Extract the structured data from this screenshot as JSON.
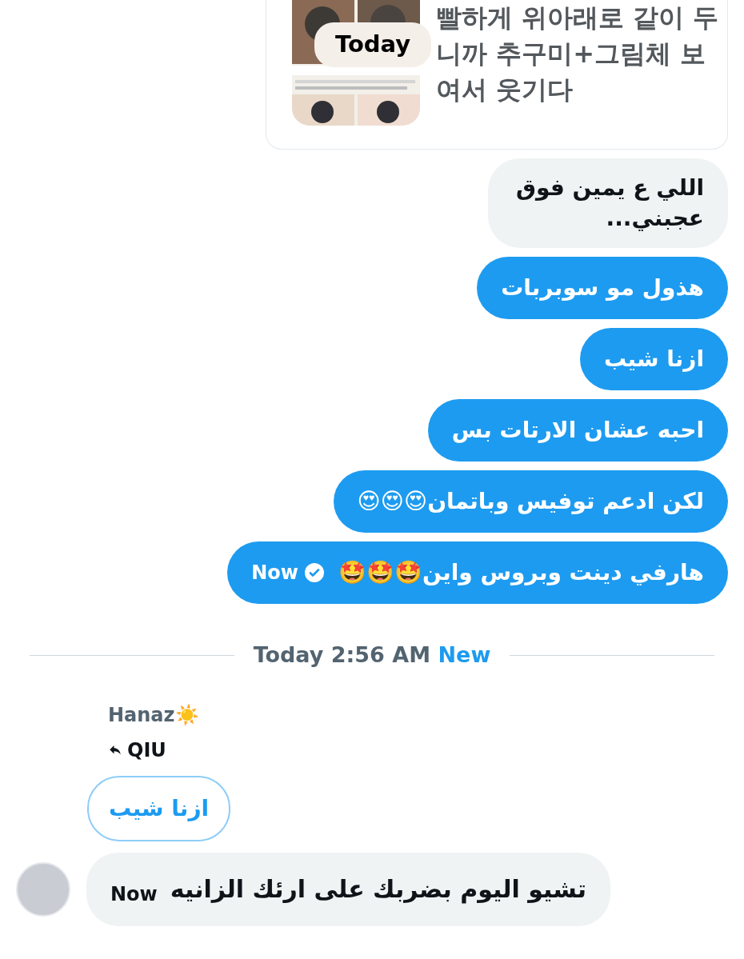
{
  "shared_card": {
    "kind": "picture",
    "badge": "Today",
    "text": [
      "빨하게 위아래로 같이 두",
      "니까 추구미+그림체 보",
      "여서 웃기다"
    ]
  },
  "messages": [
    {
      "kind": "received",
      "text": "اللي ع يمين فوق عجبني..."
    },
    {
      "kind": "sent",
      "text": "هذول مو سوبربات"
    },
    {
      "kind": "sent",
      "text": "ازنا شيب"
    },
    {
      "kind": "sent",
      "text": "احبه عشان الارتات بس"
    },
    {
      "kind": "sent",
      "text": "لكن ادعم توفيس وباتمان😍😍😍"
    },
    {
      "kind": "sent",
      "text": "هارفي دينت وبروس واين🤩🤩🤩",
      "time": "Now",
      "read": true
    }
  ],
  "divider": {
    "time": "Today 2:56 AM",
    "badge": "New"
  },
  "incoming": {
    "sender": "Hanaz☀️",
    "reply_to": "QIU",
    "quoted": "ازنا شيب",
    "text": "تشيو اليوم بضربك على ارئك الزانيه",
    "time": "Now"
  }
}
